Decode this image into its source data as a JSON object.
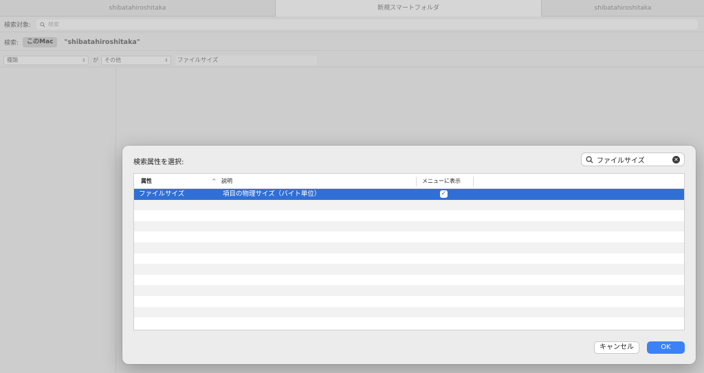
{
  "tabs": [
    {
      "label": "shibatahiroshitaka"
    },
    {
      "label": "新規スマートフォルダ"
    },
    {
      "label": "shibatahiroshitaka"
    }
  ],
  "search_bar": {
    "label": "検索対象:",
    "placeholder": "検索"
  },
  "scope": {
    "label": "検索:",
    "this_mac": "このMac",
    "folder": "\"shibatahiroshitaka\""
  },
  "criteria": {
    "kind_popup": "種類",
    "connector": "が",
    "value_popup": "その他",
    "field_value": "ファイルサイズ"
  },
  "dialog": {
    "title": "検索属性を選択:",
    "search_value": "ファイルサイズ",
    "columns": {
      "attribute": "属性",
      "sort_indicator": "^",
      "description": "説明",
      "show_in_menu": "メニューに表示"
    },
    "rows": [
      {
        "attribute": "ファイルサイズ",
        "description": "項目の物理サイズ（バイト単位）",
        "show_in_menu": true
      }
    ],
    "cancel_label": "キャンセル",
    "ok_label": "OK"
  },
  "colors": {
    "selection": "#2f6fd6",
    "ok_button": "#3c82f6"
  },
  "icons": {
    "search": "magnifying-glass",
    "clear": "x-circle",
    "check": "checkmark",
    "popup_arrows": "up-down-chevrons"
  }
}
